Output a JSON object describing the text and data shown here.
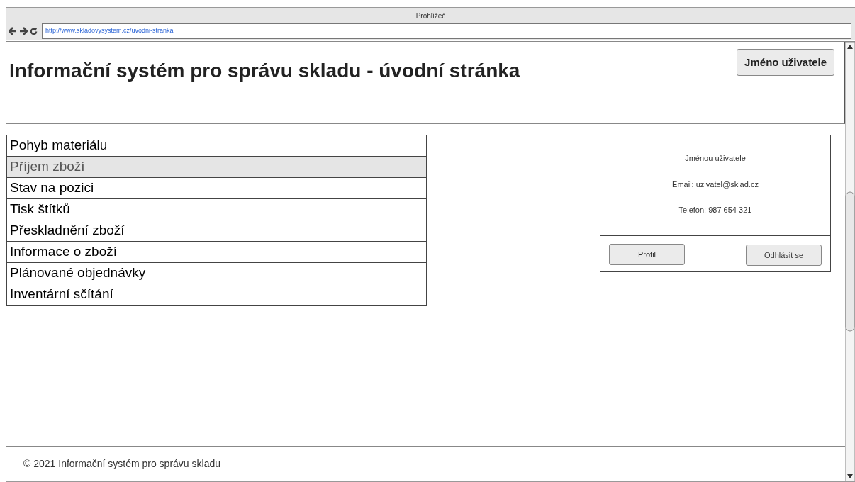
{
  "window": {
    "title": "Prohlížeč",
    "url": "http://www.skladovysystem.cz/uvodni-stranka"
  },
  "header": {
    "title": "Informační systém pro správu skladu - úvodní stránka",
    "user_button": "Jméno uživatele"
  },
  "menu": [
    {
      "label": "Pohyb materiálu",
      "selected": false
    },
    {
      "label": "Příjem zboží",
      "selected": true
    },
    {
      "label": "Stav na pozici",
      "selected": false
    },
    {
      "label": "Tisk štítků",
      "selected": false
    },
    {
      "label": "Přeskladnění zboží",
      "selected": false
    },
    {
      "label": "Informace o zboží",
      "selected": false
    },
    {
      "label": "Plánované objednávky",
      "selected": false
    },
    {
      "label": "Inventární sčítání",
      "selected": false
    }
  ],
  "user_card": {
    "name": "Jménou uživatele",
    "email": "Email: uzivatel@sklad.cz",
    "phone": "Telefon: 987 654 321",
    "buttons": [
      "Profil",
      "Odhlásit se"
    ]
  },
  "footer": "© 2021 Informační systém pro správu skladu"
}
